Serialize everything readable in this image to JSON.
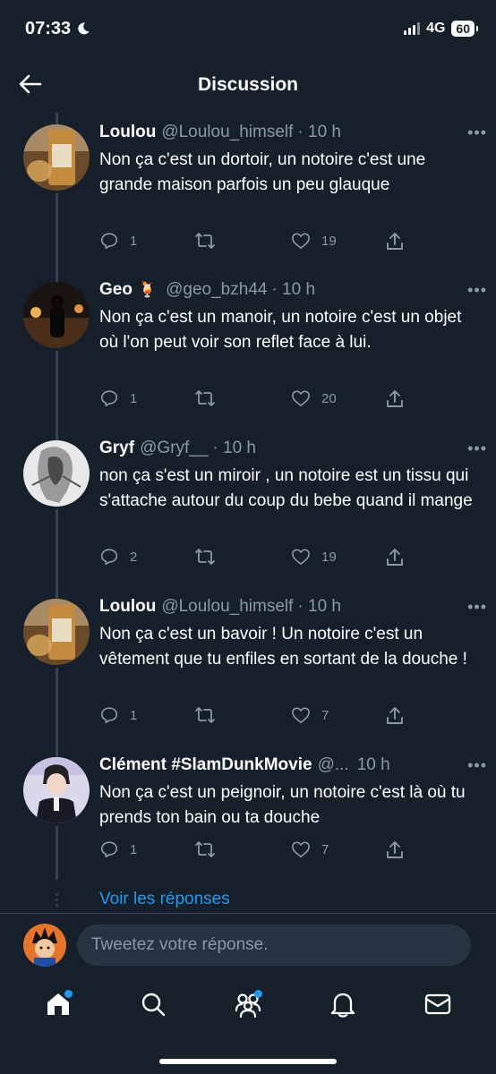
{
  "status_bar": {
    "time": "07:33",
    "network": "4G",
    "battery": "60"
  },
  "header": {
    "title": "Discussion"
  },
  "tweets": [
    {
      "name": "Loulou",
      "emoji": "",
      "handle": "@Loulou_himself",
      "time": "· 10 h",
      "text": "Non ça c'est un dortoir, un notoire c'est une grande maison parfois un peu glauque",
      "replies": "1",
      "retweets": "",
      "likes": "19"
    },
    {
      "name": "Geo",
      "emoji": "🍹",
      "handle": "@geo_bzh44",
      "time": "· 10 h",
      "text": "Non ça c'est un manoir, un notoire c'est un objet où l'on peut voir son reflet face à lui.",
      "replies": "1",
      "retweets": "",
      "likes": "20"
    },
    {
      "name": "Gryf",
      "emoji": "",
      "handle": "@Gryf__",
      "time": "· 10 h",
      "text": "non ça s'est un miroir , un notoire est un tissu qui s'attache autour du coup du bebe quand il mange",
      "replies": "2",
      "retweets": "",
      "likes": "19"
    },
    {
      "name": "Loulou",
      "emoji": "",
      "handle": "@Loulou_himself",
      "time": "· 10 h",
      "text": "Non ça c'est un bavoir ! Un notoire c'est un vêtement que tu enfiles en sortant de la douche !",
      "replies": "1",
      "retweets": "",
      "likes": "7"
    },
    {
      "name": "Clément #SlamDunkMovie",
      "emoji": "",
      "handle": "@...",
      "time": "10 h",
      "text": "Non ça c'est un peignoir, un notoire c'est là où tu prends ton bain ou ta douche",
      "replies": "1",
      "retweets": "",
      "likes": "7"
    }
  ],
  "see_replies": "Voir les réponses",
  "reply": {
    "placeholder": "Tweetez votre réponse."
  },
  "icons": {
    "back": "arrow-left-icon",
    "reply": "reply-icon",
    "retweet": "retweet-icon",
    "like": "heart-icon",
    "share": "share-icon",
    "more": "more-icon",
    "tabs": [
      "home-icon",
      "search-icon",
      "communities-icon",
      "bell-icon",
      "mail-icon"
    ]
  },
  "colors": {
    "background": "#15202b",
    "accent": "#1d9bf0",
    "muted": "#8b98a5"
  }
}
